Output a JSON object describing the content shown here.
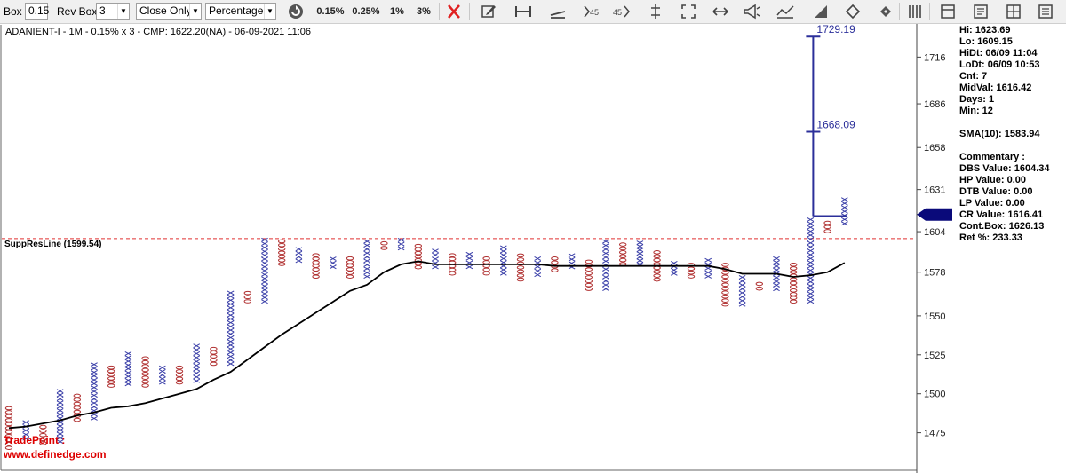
{
  "toolbar": {
    "box_label": "Box",
    "box_value": "0.15",
    "rev_box_label": "Rev Box",
    "rev_box_value": "3",
    "price_type": "Close Only",
    "method": "Percentage",
    "presets": [
      "0.15%",
      "0.25%",
      "1%",
      "3%"
    ],
    "icons": [
      "refresh-icon",
      "close-x-icon",
      "edit-icon",
      "ruler-icon",
      "trendline-icon",
      "angle45-down-icon",
      "angle45-up-icon",
      "vertical-line-icon",
      "expand-icon",
      "horizontal-arrows-icon",
      "megaphone-icon",
      "chart-lines-icon",
      "triangle-icon",
      "diamond-arrows-icon",
      "columns-icon",
      "panel-icon",
      "report-icon",
      "grid-icon",
      "list-icon"
    ],
    "icon_labels": {
      "angle45_down": "45",
      "angle45_up": "45"
    }
  },
  "chart_data": {
    "type": "point-and-figure",
    "title": "ADANIENT-I - 1M - 0.15% x 3 - CMP: 1622.20(NA) - 06-09-2021 11:06",
    "y_ticks": [
      1475,
      1500,
      1525,
      1550,
      1578,
      1604,
      1631,
      1658,
      1686,
      1716
    ],
    "ylim": [
      1452,
      1735
    ],
    "support_resistance": {
      "label": "SuppResLine (1599.54)",
      "value": 1599.54,
      "color": "#e03030"
    },
    "current_price_marker": 1615,
    "x_colors": "#3a3fa8",
    "o_colors": "#b03030",
    "columns": [
      {
        "type": "O",
        "high": 1492,
        "low": 1464
      },
      {
        "type": "X",
        "high": 1483,
        "low": 1470
      },
      {
        "type": "O",
        "high": 1480,
        "low": 1467
      },
      {
        "type": "X",
        "high": 1503,
        "low": 1468
      },
      {
        "type": "O",
        "high": 1500,
        "low": 1482
      },
      {
        "type": "X",
        "high": 1520,
        "low": 1483
      },
      {
        "type": "O",
        "high": 1518,
        "low": 1504
      },
      {
        "type": "X",
        "high": 1527,
        "low": 1505
      },
      {
        "type": "O",
        "high": 1524,
        "low": 1504
      },
      {
        "type": "X",
        "high": 1518,
        "low": 1506
      },
      {
        "type": "O",
        "high": 1518,
        "low": 1506
      },
      {
        "type": "X",
        "high": 1532,
        "low": 1507
      },
      {
        "type": "O",
        "high": 1530,
        "low": 1518
      },
      {
        "type": "X",
        "high": 1566,
        "low": 1518
      },
      {
        "type": "O",
        "high": 1566,
        "low": 1558
      },
      {
        "type": "X",
        "high": 1600,
        "low": 1558
      },
      {
        "type": "O",
        "high": 1599,
        "low": 1582
      },
      {
        "type": "X",
        "high": 1594,
        "low": 1584
      },
      {
        "type": "O",
        "high": 1590,
        "low": 1574
      },
      {
        "type": "X",
        "high": 1588,
        "low": 1580
      },
      {
        "type": "O",
        "high": 1588,
        "low": 1574
      },
      {
        "type": "X",
        "high": 1599,
        "low": 1574
      },
      {
        "type": "O",
        "high": 1598,
        "low": 1592
      },
      {
        "type": "X",
        "high": 1600,
        "low": 1592
      },
      {
        "type": "O",
        "high": 1596,
        "low": 1580
      },
      {
        "type": "X",
        "high": 1593,
        "low": 1580
      },
      {
        "type": "O",
        "high": 1590,
        "low": 1576
      },
      {
        "type": "X",
        "high": 1591,
        "low": 1580
      },
      {
        "type": "O",
        "high": 1588,
        "low": 1576
      },
      {
        "type": "X",
        "high": 1595,
        "low": 1576
      },
      {
        "type": "O",
        "high": 1590,
        "low": 1572
      },
      {
        "type": "X",
        "high": 1588,
        "low": 1575
      },
      {
        "type": "O",
        "high": 1588,
        "low": 1578
      },
      {
        "type": "X",
        "high": 1590,
        "low": 1580
      },
      {
        "type": "O",
        "high": 1586,
        "low": 1566
      },
      {
        "type": "X",
        "high": 1599,
        "low": 1566
      },
      {
        "type": "O",
        "high": 1597,
        "low": 1582
      },
      {
        "type": "X",
        "high": 1598,
        "low": 1582
      },
      {
        "type": "O",
        "high": 1592,
        "low": 1572
      },
      {
        "type": "X",
        "high": 1585,
        "low": 1576
      },
      {
        "type": "O",
        "high": 1584,
        "low": 1574
      },
      {
        "type": "X",
        "high": 1587,
        "low": 1574
      },
      {
        "type": "O",
        "high": 1584,
        "low": 1556
      },
      {
        "type": "X",
        "high": 1576,
        "low": 1556
      },
      {
        "type": "O",
        "high": 1572,
        "low": 1566
      },
      {
        "type": "X",
        "high": 1588,
        "low": 1566
      },
      {
        "type": "O",
        "high": 1584,
        "low": 1558
      },
      {
        "type": "X",
        "high": 1613,
        "low": 1558
      },
      {
        "type": "O",
        "high": 1611,
        "low": 1603
      },
      {
        "type": "X",
        "high": 1626,
        "low": 1608
      }
    ],
    "sma": {
      "label": "SMA(10)",
      "points": [
        [
          0,
          1478
        ],
        [
          1,
          1479
        ],
        [
          2,
          1481
        ],
        [
          3,
          1483
        ],
        [
          4,
          1486
        ],
        [
          5,
          1488
        ],
        [
          6,
          1491
        ],
        [
          7,
          1492
        ],
        [
          8,
          1494
        ],
        [
          9,
          1497
        ],
        [
          10,
          1500
        ],
        [
          11,
          1503
        ],
        [
          12,
          1509
        ],
        [
          13,
          1514
        ],
        [
          14,
          1522
        ],
        [
          15,
          1530
        ],
        [
          16,
          1538
        ],
        [
          17,
          1545
        ],
        [
          18,
          1552
        ],
        [
          19,
          1559
        ],
        [
          20,
          1566
        ],
        [
          21,
          1570
        ],
        [
          22,
          1578
        ],
        [
          23,
          1583
        ],
        [
          24,
          1585
        ],
        [
          25,
          1583
        ],
        [
          26,
          1583
        ],
        [
          27,
          1583
        ],
        [
          28,
          1583
        ],
        [
          29,
          1583
        ],
        [
          30,
          1583
        ],
        [
          31,
          1583
        ],
        [
          32,
          1582
        ],
        [
          33,
          1582
        ],
        [
          34,
          1582
        ],
        [
          35,
          1582
        ],
        [
          36,
          1582
        ],
        [
          37,
          1582
        ],
        [
          38,
          1582
        ],
        [
          39,
          1582
        ],
        [
          40,
          1582
        ],
        [
          41,
          1582
        ],
        [
          42,
          1580
        ],
        [
          43,
          1577
        ],
        [
          44,
          1577
        ],
        [
          45,
          1577
        ],
        [
          46,
          1575
        ],
        [
          47,
          1576
        ],
        [
          48,
          1578
        ],
        [
          49,
          1584
        ]
      ]
    },
    "projection": {
      "base": 1614,
      "targets": [
        1668.09,
        1729.19
      ],
      "target_labels": [
        "1668.09",
        "1729.19"
      ],
      "color": "#2b2f9a"
    }
  },
  "info_panel": {
    "lines": [
      "Hi: 1623.69",
      "Lo: 1609.15",
      "HiDt: 06/09 11:04",
      "LoDt: 06/09 10:53",
      "Cnt: 7",
      "MidVal: 1616.42",
      "Days: 1",
      "Min: 12",
      "",
      "SMA(10): 1583.94",
      "",
      "Commentary :",
      "DBS Value:  1604.34",
      "HP Value: 0.00",
      "DTB Value: 0.00",
      "LP Value: 0.00",
      "CR Value: 1616.41",
      "Cont.Box: 1626.13",
      "Ret %: 233.33"
    ]
  },
  "watermark": {
    "line1": "TradePoint :",
    "line2": "www.definedge.com",
    "color": "#dd0000"
  }
}
